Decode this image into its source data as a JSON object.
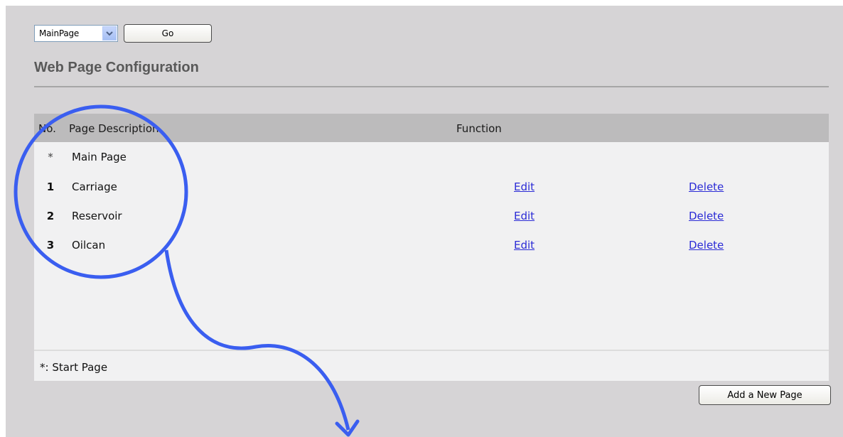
{
  "toolbar": {
    "page_select_value": "MainPage",
    "go_label": "Go"
  },
  "page": {
    "title": "Web Page Configuration"
  },
  "table": {
    "columns": {
      "no": "No.",
      "description": "Page Description",
      "function": "Function"
    },
    "rows": [
      {
        "no": "*",
        "description": "Main Page",
        "edit": "",
        "delete": ""
      },
      {
        "no": "1",
        "description": "Carriage",
        "edit": "Edit",
        "delete": "Delete"
      },
      {
        "no": "2",
        "description": "Reservoir",
        "edit": "Edit",
        "delete": "Delete"
      },
      {
        "no": "3",
        "description": "Oilcan",
        "edit": "Edit",
        "delete": "Delete"
      }
    ],
    "footer_note": "*: Start Page"
  },
  "actions": {
    "add_page_label": "Add a New Page"
  },
  "colors": {
    "background": "#d6d4d6",
    "table_header": "#bcbbbc",
    "table_body": "#f1f1f2",
    "link": "#2b2bd6",
    "annotation": "#3a5ef0"
  },
  "icons": {
    "dropdown": "chevron-down-icon",
    "annotation": "circle-highlight-with-arrow"
  }
}
